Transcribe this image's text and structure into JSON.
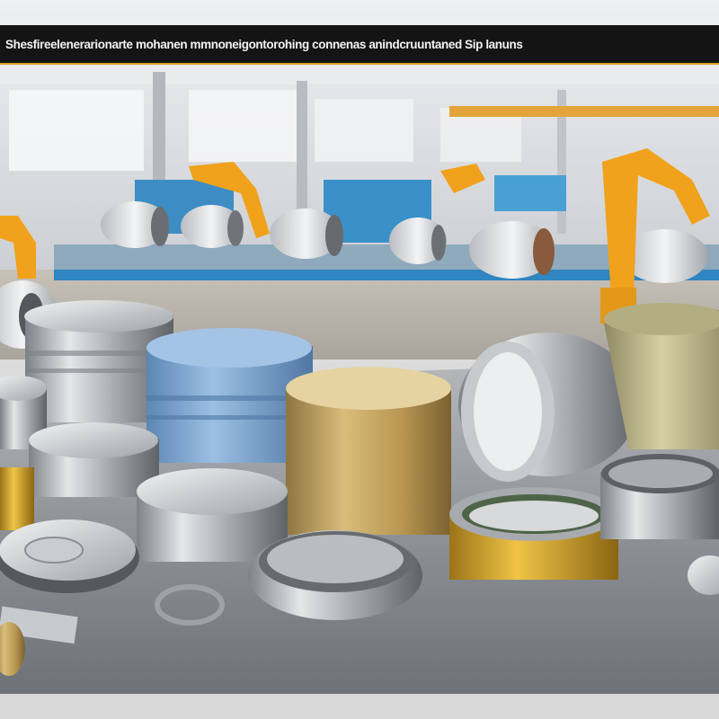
{
  "caption": {
    "text": "Shesfireelenerarionarte mohanen mmnoneigontorohing connenas anindcruuntaned Sip lanuns"
  },
  "scene_items": {
    "factory_background": "factory-hall",
    "robot_arm_icon": "robot-arm",
    "metal_coils": "metal-coils",
    "containers": "metal-containers"
  },
  "colors": {
    "accent_yellow": "#d9a21e",
    "robot_orange": "#f0a21c",
    "machine_blue": "#2f86c0",
    "gold_tin": "#c9a963",
    "blue_tin": "#7aa6d4"
  }
}
